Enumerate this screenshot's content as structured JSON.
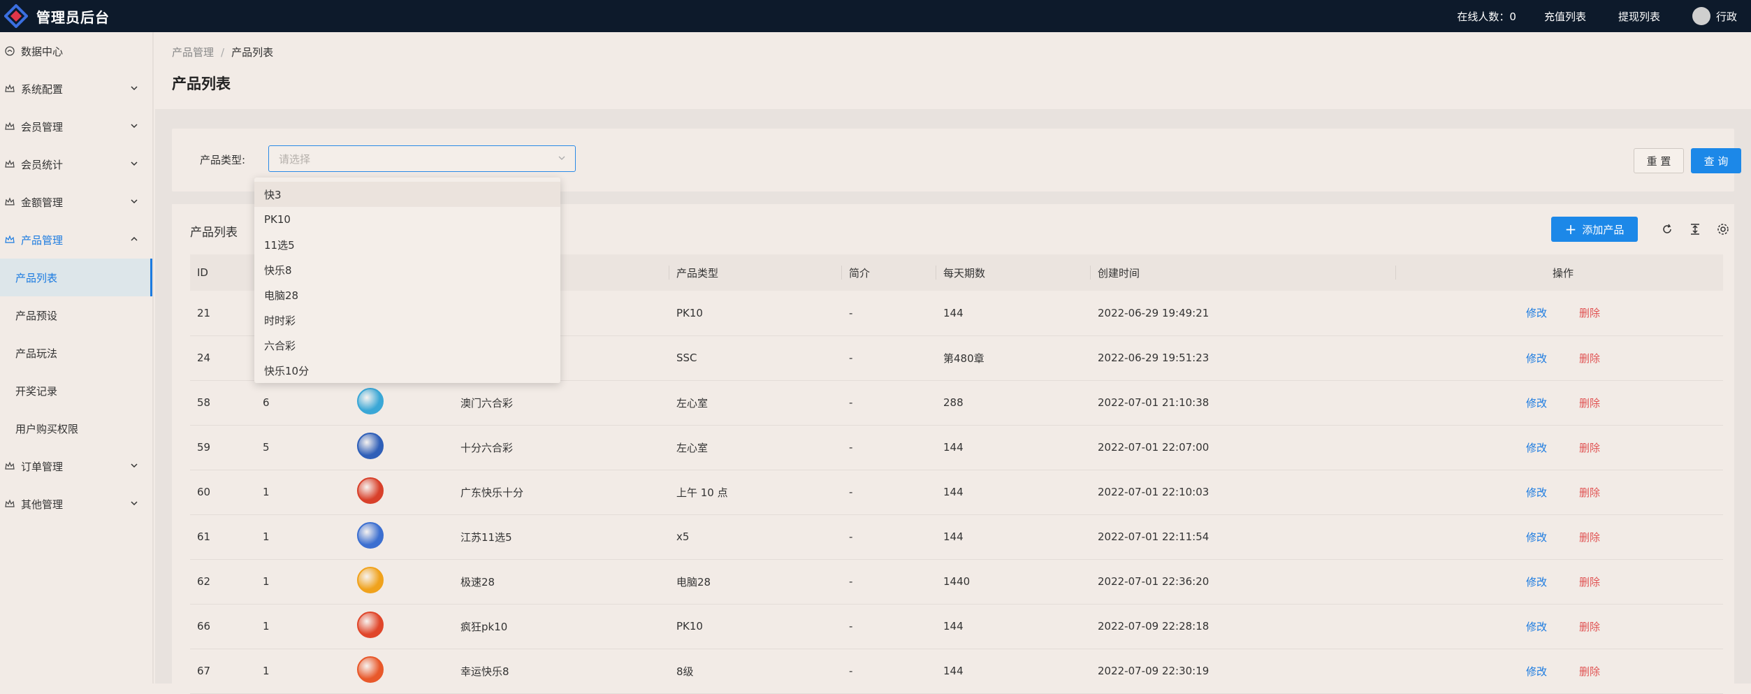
{
  "header": {
    "app_title": "管理员后台",
    "online_label": "在线人数：0",
    "recharge_link": "充值列表",
    "withdraw_link": "提现列表",
    "user_name": "行政"
  },
  "sidebar": {
    "items": [
      {
        "label": "数据中心",
        "icon": "dashboard-icon"
      },
      {
        "label": "系统配置",
        "icon": "crown-icon"
      },
      {
        "label": "会员管理",
        "icon": "crown-icon"
      },
      {
        "label": "会员统计",
        "icon": "crown-icon"
      },
      {
        "label": "金额管理",
        "icon": "crown-icon"
      },
      {
        "label": "产品管理",
        "icon": "crown-icon"
      },
      {
        "label": "订单管理",
        "icon": "crown-icon"
      },
      {
        "label": "其他管理",
        "icon": "crown-icon"
      }
    ],
    "product_sub": [
      "产品列表",
      "产品预设",
      "产品玩法",
      "开奖记录",
      "用户购买权限"
    ]
  },
  "breadcrumb": {
    "parent": "产品管理",
    "separator": "/",
    "current": "产品列表"
  },
  "page_title": "产品列表",
  "filter": {
    "label": "产品类型:",
    "placeholder": "请选择",
    "reset_label": "重 置",
    "query_label": "查 询",
    "options": [
      "快3",
      "PK10",
      "11选5",
      "快乐8",
      "电脑28",
      "时时彩",
      "六合彩",
      "快乐10分"
    ]
  },
  "table": {
    "title": "产品列表",
    "add_label": "添加产品",
    "columns": [
      "ID",
      "",
      "",
      "",
      "产品类型",
      "简介",
      "每天期数",
      "创建时间",
      "操作"
    ],
    "edit_label": "修改",
    "delete_label": "删除",
    "rows": [
      {
        "id": "21",
        "sort": "",
        "name": "",
        "type": "PK10",
        "intro": "-",
        "periods": "144",
        "created": "2022-06-29 19:49:21",
        "thumb_color": ""
      },
      {
        "id": "24",
        "sort": "",
        "name": "",
        "type": "SSC",
        "intro": "-",
        "periods": "第480章",
        "created": "2022-06-29 19:51:23",
        "thumb_color": ""
      },
      {
        "id": "58",
        "sort": "6",
        "name": "澳门六合彩",
        "type": "左心室",
        "intro": "-",
        "periods": "288",
        "created": "2022-07-01 21:10:38",
        "thumb_color": "#3aa7d6"
      },
      {
        "id": "59",
        "sort": "5",
        "name": "十分六合彩",
        "type": "左心室",
        "intro": "-",
        "periods": "144",
        "created": "2022-07-01 22:07:00",
        "thumb_color": "#2f5fb8"
      },
      {
        "id": "60",
        "sort": "1",
        "name": "广东快乐十分",
        "type": "上午 10 点",
        "intro": "-",
        "periods": "144",
        "created": "2022-07-01 22:10:03",
        "thumb_color": "#d8402a"
      },
      {
        "id": "61",
        "sort": "1",
        "name": "江苏11选5",
        "type": "x5",
        "intro": "-",
        "periods": "144",
        "created": "2022-07-01 22:11:54",
        "thumb_color": "#3c6fd0"
      },
      {
        "id": "62",
        "sort": "1",
        "name": "极速28",
        "type": "电脑28",
        "intro": "-",
        "periods": "1440",
        "created": "2022-07-01 22:36:20",
        "thumb_color": "#f0a21c"
      },
      {
        "id": "66",
        "sort": "1",
        "name": "疯狂pk10",
        "type": "PK10",
        "intro": "-",
        "periods": "144",
        "created": "2022-07-09 22:28:18",
        "thumb_color": "#e0462a"
      },
      {
        "id": "67",
        "sort": "1",
        "name": "幸运快乐8",
        "type": "8级",
        "intro": "-",
        "periods": "144",
        "created": "2022-07-09 22:30:19",
        "thumb_color": "#e8582a"
      }
    ]
  },
  "colors": {
    "accent": "#1c88e8",
    "danger": "#e05353",
    "header_bg": "#0d1a2b"
  }
}
